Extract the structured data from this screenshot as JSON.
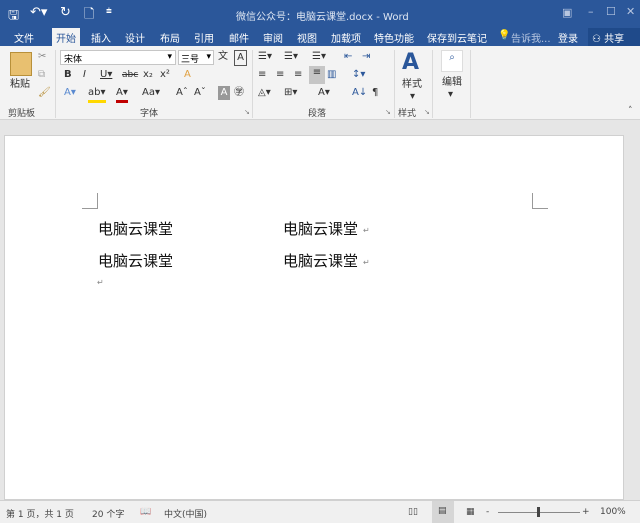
{
  "title_bar": {
    "title": "微信公众号：电脑云课堂.docx - Word",
    "quick_access": [
      "save-icon",
      "undo-icon",
      "redo-icon",
      "new-doc-icon",
      "customize-icon"
    ],
    "window_controls": [
      "ribbon-display-icon",
      "minimize-icon",
      "maximize-icon",
      "close-icon"
    ]
  },
  "tabs": [
    {
      "label": "文件"
    },
    {
      "label": "开始",
      "active": true
    },
    {
      "label": "插入"
    },
    {
      "label": "设计"
    },
    {
      "label": "布局"
    },
    {
      "label": "引用"
    },
    {
      "label": "邮件"
    },
    {
      "label": "审阅"
    },
    {
      "label": "视图"
    },
    {
      "label": "加载项"
    },
    {
      "label": "特色功能"
    },
    {
      "label": "保存到云笔记"
    }
  ],
  "tell_me": "告诉我...",
  "login": "登录",
  "share": "共享",
  "ribbon": {
    "clipboard": {
      "paste": "粘贴",
      "label": "剪贴板"
    },
    "font": {
      "font_name": "宋体",
      "font_size": "三号",
      "label": "字体"
    },
    "paragraph": {
      "label": "段落"
    },
    "styles": {
      "button": "样式",
      "label": "样式"
    },
    "editing": {
      "button": "编辑"
    }
  },
  "document": {
    "lines": [
      [
        "电脑云课堂",
        "电脑云课堂"
      ],
      [
        "电脑云课堂",
        "电脑云课堂"
      ]
    ],
    "return_mark": "↵"
  },
  "status": {
    "page": "第 1 页，共 1 页",
    "words": "20 个字",
    "language": "中文(中国)",
    "zoom": "100%",
    "zoom_percent": 100
  },
  "colors": {
    "brand": "#2b579a",
    "font_color": "#c00000",
    "highlight": "#ffd800"
  }
}
